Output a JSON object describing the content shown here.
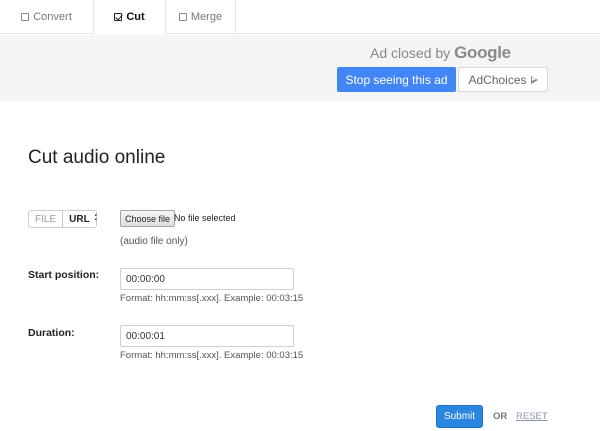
{
  "tabs": [
    {
      "label": "Convert",
      "checked": false
    },
    {
      "label": "Cut",
      "checked": true
    },
    {
      "label": "Merge",
      "checked": false
    }
  ],
  "ad": {
    "closed_text": "Ad closed by",
    "google": "Google",
    "stop_label": "Stop seeing this ad",
    "adchoices_label": "AdChoices"
  },
  "page": {
    "title": "Cut audio online"
  },
  "source": {
    "file_label": "FILE",
    "url_label": "URL",
    "colon": ":",
    "choose_button": "Choose file",
    "status": "No file selected",
    "hint": "(audio file only)"
  },
  "start": {
    "label": "Start position:",
    "value": "00:00:00",
    "hint": "Format: hh:mm:ss[.xxx]. Example: 00:03:15"
  },
  "duration": {
    "label": "Duration:",
    "value": "00:00:01",
    "hint": "Format: hh:mm:ss[.xxx]. Example: 00:03:15"
  },
  "actions": {
    "submit": "Submit",
    "or": "OR",
    "reset": "RESET"
  },
  "colors": {
    "accent": "#2a86e0",
    "ad_button": "#4285f4"
  }
}
